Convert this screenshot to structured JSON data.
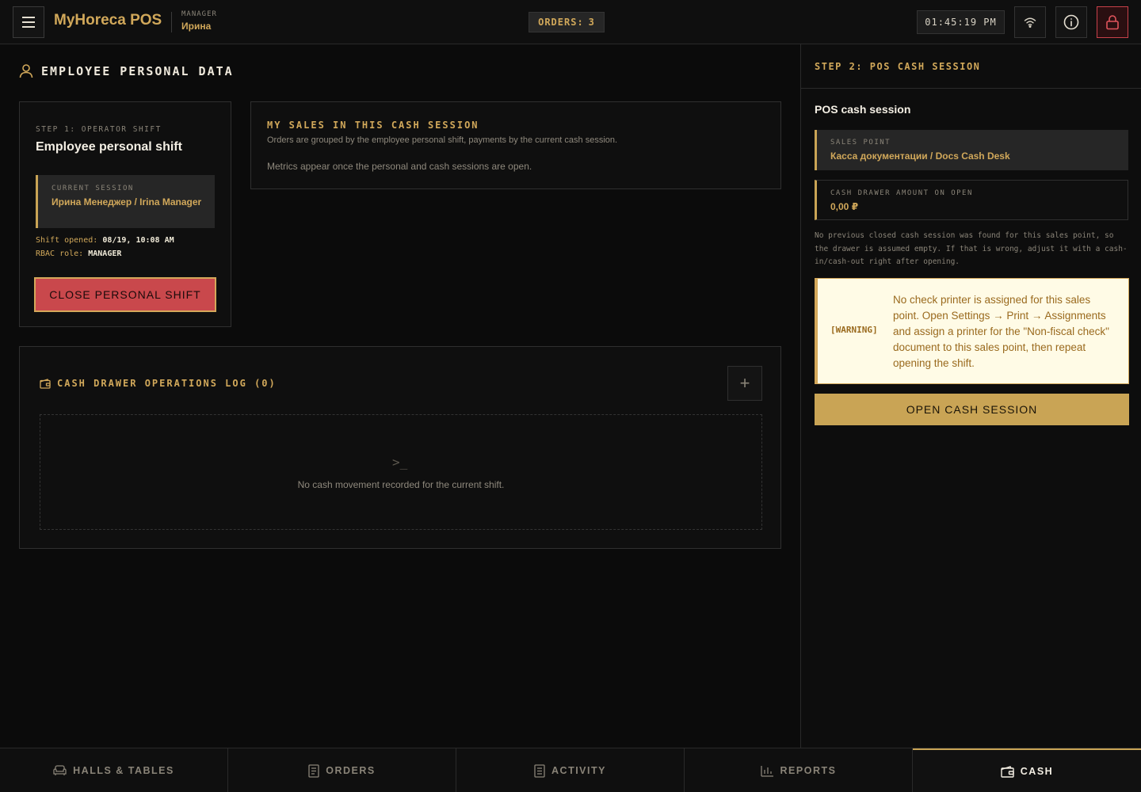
{
  "header": {
    "brand": "MyHoreca POS",
    "role_label": "MANAGER",
    "user_name": "Ирина",
    "orders_label": "ORDERS:",
    "orders_count": "3",
    "clock": "01:45:19 PM"
  },
  "main": {
    "section_title": "EMPLOYEE PERSONAL DATA",
    "shift_card": {
      "step_label": "STEP 1: OPERATOR SHIFT",
      "title": "Employee personal shift",
      "session_label": "CURRENT SESSION",
      "session_value": "Ирина Менеджер / Irina Manager",
      "opened_label": "Shift opened:",
      "opened_value": "08/19, 10:08 AM",
      "rbac_label": "RBAC role:",
      "rbac_value": "MANAGER",
      "close_button": "CLOSE PERSONAL SHIFT"
    },
    "sales_card": {
      "title": "MY SALES IN THIS CASH SESSION",
      "subtitle": "Orders are grouped by the employee personal shift, payments by the current cash session.",
      "note": "Metrics appear once the personal and cash sessions are open."
    },
    "log_card": {
      "title": "CASH DRAWER OPERATIONS LOG (0)",
      "add_symbol": "+",
      "empty_glyph": ">_",
      "empty_text": "No cash movement recorded for the current shift."
    }
  },
  "right_panel": {
    "step": "STEP 2: POS CASH SESSION",
    "title": "POS cash session",
    "sales_point_label": "SALES POINT",
    "sales_point_value": "Касса документации / Docs Cash Desk",
    "drawer_label": "CASH DRAWER AMOUNT ON OPEN",
    "drawer_value": "0,00 ₽",
    "note": "No previous closed cash session was found for this sales point, so the drawer is assumed empty. If that is wrong, adjust it with a cash-in/cash-out right after opening.",
    "warning_tag": "[WARNING]",
    "warning_text": "No check printer is assigned for this sales point. Open Settings → Print → Assignments and assign a printer for the \"Non-fiscal check\" document to this sales point, then repeat opening the shift.",
    "open_button": "OPEN CASH SESSION"
  },
  "bottom_nav": {
    "items": [
      {
        "label": "HALLS & TABLES",
        "icon": "sofa-icon"
      },
      {
        "label": "ORDERS",
        "icon": "document-icon"
      },
      {
        "label": "ACTIVITY",
        "icon": "list-icon"
      },
      {
        "label": "REPORTS",
        "icon": "bar-chart-icon"
      },
      {
        "label": "CASH",
        "icon": "wallet-icon"
      }
    ],
    "active": "CASH"
  },
  "colors": {
    "accent": "#c9a455",
    "danger": "#c9484c",
    "background": "#0b0b0b",
    "warning_bg": "#fffbe6"
  }
}
